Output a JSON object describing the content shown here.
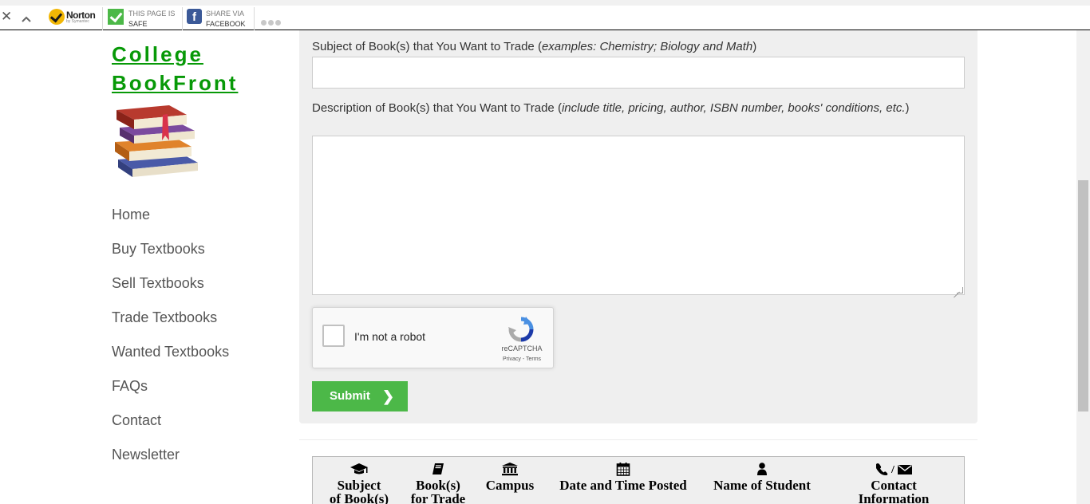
{
  "toolbar": {
    "norton": {
      "brand": "Norton",
      "byline": "by Symantec"
    },
    "safe": {
      "line1": "THIS PAGE IS",
      "line2": "SAFE"
    },
    "share": {
      "line1": "SHARE VIA",
      "line2": "FACEBOOK",
      "fb_glyph": "f"
    },
    "close_glyph": "✕"
  },
  "brand": {
    "line1": "College",
    "line2": "BookFront"
  },
  "nav": {
    "items": [
      {
        "label": "Home"
      },
      {
        "label": "Buy Textbooks"
      },
      {
        "label": "Sell Textbooks"
      },
      {
        "label": "Trade Textbooks"
      },
      {
        "label": "Wanted Textbooks"
      },
      {
        "label": "FAQs"
      },
      {
        "label": "Contact"
      },
      {
        "label": "Newsletter"
      }
    ]
  },
  "form": {
    "subject_label": "Subject of Book(s) that You Want to Trade (",
    "subject_example": "examples: Chemistry; Biology and Math",
    "subject_close": ")",
    "subject_value": "",
    "description_label": "Description of Book(s) that You Want to Trade (",
    "description_example": "include title, pricing, author, ISBN number, books' conditions, etc.",
    "description_close": ")",
    "description_value": "",
    "captcha": {
      "label": "I'm not a robot",
      "brand": "reCAPTCHA",
      "links": "Privacy - Terms"
    },
    "submit_label": "Submit",
    "submit_arrow": "❯"
  },
  "table": {
    "columns": [
      {
        "l1": "Subject",
        "l2": "of Book(s)",
        "icon": "graduation-cap-icon"
      },
      {
        "l1": "Book(s)",
        "l2": "for Trade",
        "icon": "book-icon"
      },
      {
        "l1": "Campus",
        "l2": "",
        "icon": "institution-icon"
      },
      {
        "l1": "Date and Time Posted",
        "l2": "",
        "icon": "calendar-icon"
      },
      {
        "l1": "Name of Student",
        "l2": "",
        "icon": "user-icon"
      },
      {
        "l1": "Contact",
        "l2": "Information",
        "icon": "phone-envelope-icon",
        "sep": "/"
      }
    ]
  },
  "colors": {
    "brand_green": "#079907",
    "submit_green": "#4cb848",
    "panel_gray": "#efefef"
  }
}
